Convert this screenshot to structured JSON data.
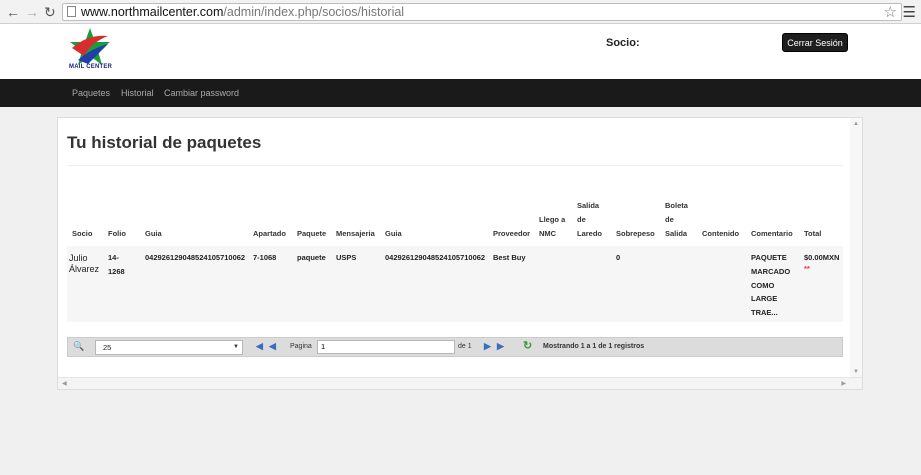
{
  "browser": {
    "url_host": "www.northmailcenter.com",
    "url_path": "/admin/index.php/socios/historial"
  },
  "header": {
    "logo_text": "MAIL CENTER",
    "socio_label": "Socio:",
    "logout_label": "Cerrar Sesión"
  },
  "nav": {
    "items": [
      "Paquetes",
      "Historial",
      "Cambiar password"
    ]
  },
  "main": {
    "title": "Tu historial de paquetes"
  },
  "table": {
    "headers": {
      "socio": "Socio",
      "folio": "Folio",
      "guia": "Guia",
      "apartado": "Apartado",
      "paquete": "Paquete",
      "mensajeria": "Mensajeria",
      "guia2": "Guia",
      "proveedor": "Proveedor",
      "llego_1": "Llego a",
      "llego_2": "NMC",
      "salida_1": "Salida",
      "salida_2": "de",
      "salida_3": "Laredo",
      "sobrepeso": "Sobrepeso",
      "boleta_1": "Boleta",
      "boleta_2": "de",
      "boleta_3": "Salida",
      "contenido": "Contenido",
      "comentario": "Comentario",
      "total": "Total"
    },
    "row": {
      "socio_1": "Julio",
      "socio_2": "Álvarez",
      "folio_1": "14-",
      "folio_2": "1268",
      "guia": "04292612904852410571006​2",
      "apartado": "7-1068",
      "paquete": "paquete",
      "mensajeria": "USPS",
      "guia2": "04292612904852410571006​2",
      "proveedor": "Best Buy",
      "sobrepeso": "0",
      "comentario_1": "PAQUETE",
      "comentario_2": "MARCADO",
      "comentario_3": "COMO",
      "comentario_4": "LARGE",
      "comentario_5": "TRAE...",
      "total": "$0.00MXN",
      "total_mark": "**"
    }
  },
  "pager": {
    "page_size": "25",
    "pagina_label": "Pagina",
    "page_value": "1",
    "of_label": "de 1",
    "info": "Mostrando 1 a 1 de 1 registros"
  },
  "colors": {
    "navbar": "#1a1a1a",
    "logout_bg": "#1e1e1e",
    "pager_icon": "#3a6cc0"
  }
}
